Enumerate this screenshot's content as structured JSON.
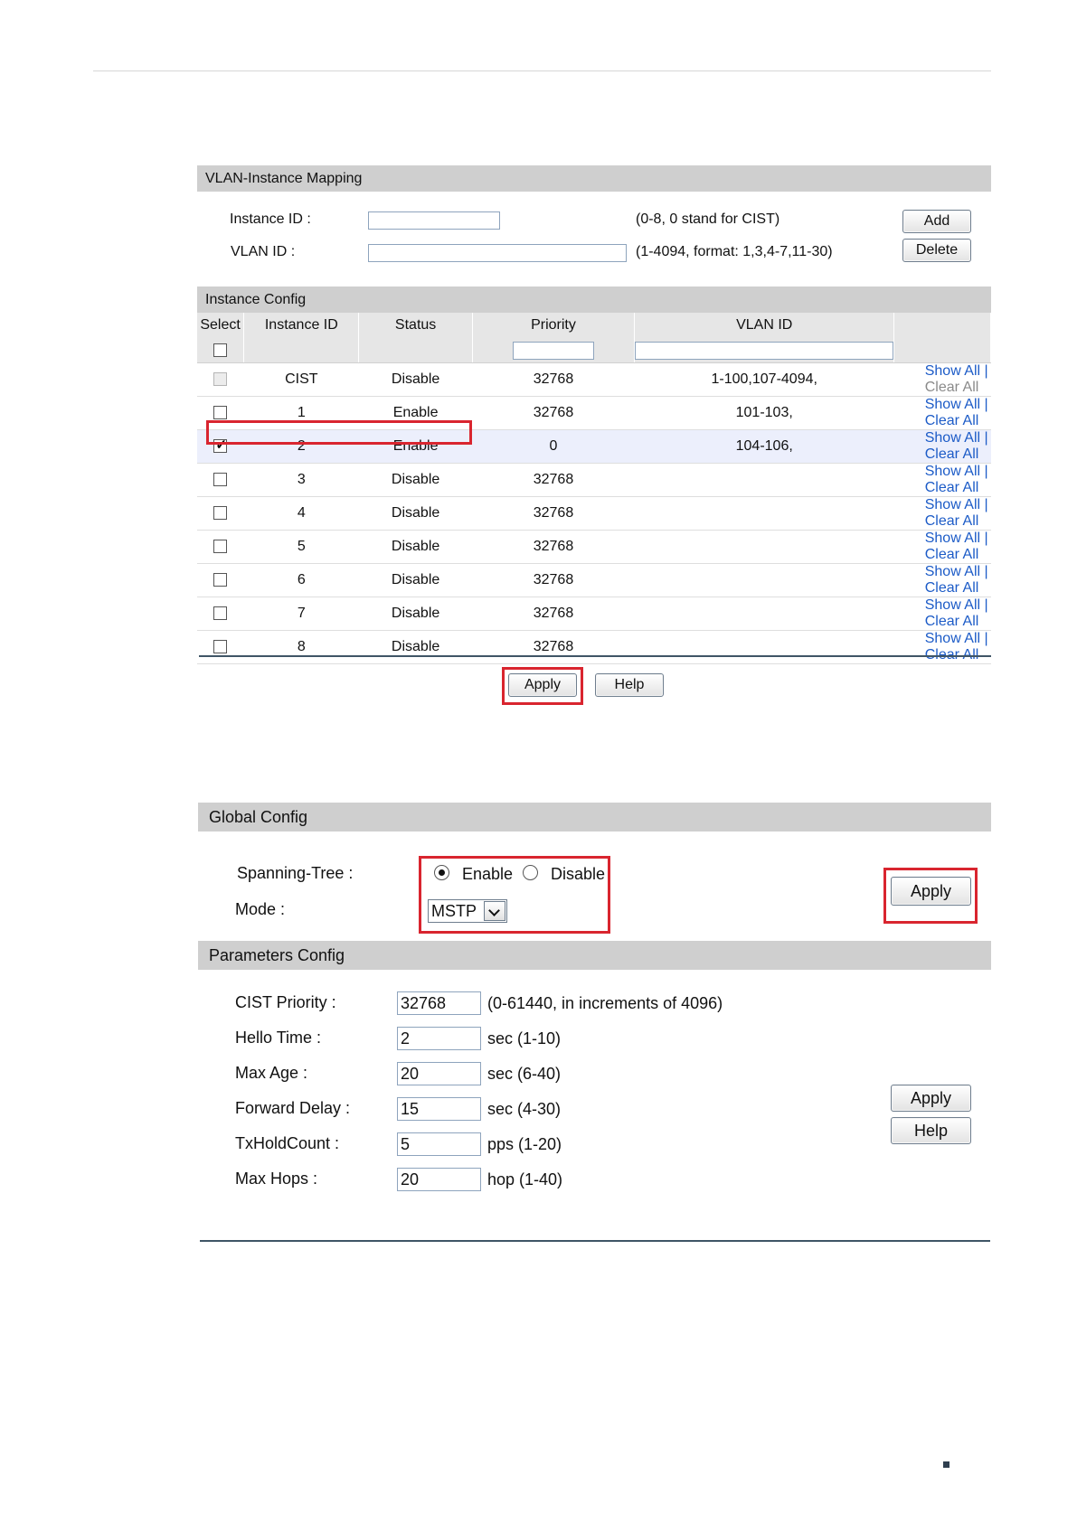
{
  "vlan_instance_mapping": {
    "title": "VLAN-Instance Mapping",
    "instance_id_label": "Instance ID :",
    "instance_id_value": "",
    "instance_id_hint": "(0-8, 0 stand for CIST)",
    "vlan_id_label": "VLAN ID :",
    "vlan_id_value": "",
    "vlan_id_hint": "(1-4094, format: 1,3,4-7,11-30)",
    "add_label": "Add",
    "delete_label": "Delete"
  },
  "instance_config": {
    "title": "Instance Config",
    "columns": [
      "Select",
      "Instance ID",
      "Status",
      "Priority",
      "VLAN ID",
      ""
    ],
    "show_all": "Show All",
    "separator": "|",
    "clear_all": "Clear All",
    "rows": [
      {
        "id": "CIST",
        "status": "Disable",
        "priority": "32768",
        "vlan": "1-100,107-4094,",
        "checked": false,
        "disabled": true
      },
      {
        "id": "1",
        "status": "Enable",
        "priority": "32768",
        "vlan": "101-103,",
        "checked": false,
        "disabled": false
      },
      {
        "id": "2",
        "status": "Enable",
        "priority": "0",
        "vlan": "104-106,",
        "checked": true,
        "disabled": false
      },
      {
        "id": "3",
        "status": "Disable",
        "priority": "32768",
        "vlan": "",
        "checked": false,
        "disabled": false
      },
      {
        "id": "4",
        "status": "Disable",
        "priority": "32768",
        "vlan": "",
        "checked": false,
        "disabled": false
      },
      {
        "id": "5",
        "status": "Disable",
        "priority": "32768",
        "vlan": "",
        "checked": false,
        "disabled": false
      },
      {
        "id": "6",
        "status": "Disable",
        "priority": "32768",
        "vlan": "",
        "checked": false,
        "disabled": false
      },
      {
        "id": "7",
        "status": "Disable",
        "priority": "32768",
        "vlan": "",
        "checked": false,
        "disabled": false
      },
      {
        "id": "8",
        "status": "Disable",
        "priority": "32768",
        "vlan": "",
        "checked": false,
        "disabled": false
      }
    ],
    "apply_label": "Apply",
    "help_label": "Help"
  },
  "global_config": {
    "title": "Global Config",
    "spanning_tree_label": "Spanning-Tree :",
    "enable_label": "Enable",
    "disable_label": "Disable",
    "spanning_tree_value": "Enable",
    "mode_label": "Mode :",
    "mode_value": "MSTP",
    "apply_label": "Apply"
  },
  "parameters_config": {
    "title": "Parameters Config",
    "params": [
      {
        "label": "CIST Priority :",
        "value": "32768",
        "hint": "(0-61440, in increments of 4096)"
      },
      {
        "label": "Hello Time :",
        "value": "2",
        "hint": "sec (1-10)"
      },
      {
        "label": "Max Age :",
        "value": "20",
        "hint": "sec (6-40)"
      },
      {
        "label": "Forward Delay :",
        "value": "15",
        "hint": "sec (4-30)"
      },
      {
        "label": "TxHoldCount :",
        "value": "5",
        "hint": "pps (1-20)"
      },
      {
        "label": "Max Hops :",
        "value": "20",
        "hint": "hop (1-40)"
      }
    ],
    "apply_label": "Apply",
    "help_label": "Help"
  },
  "colors": {
    "highlight": "#d9252f",
    "link": "#1c5bc7",
    "section_bar": "#cfcfcf"
  }
}
